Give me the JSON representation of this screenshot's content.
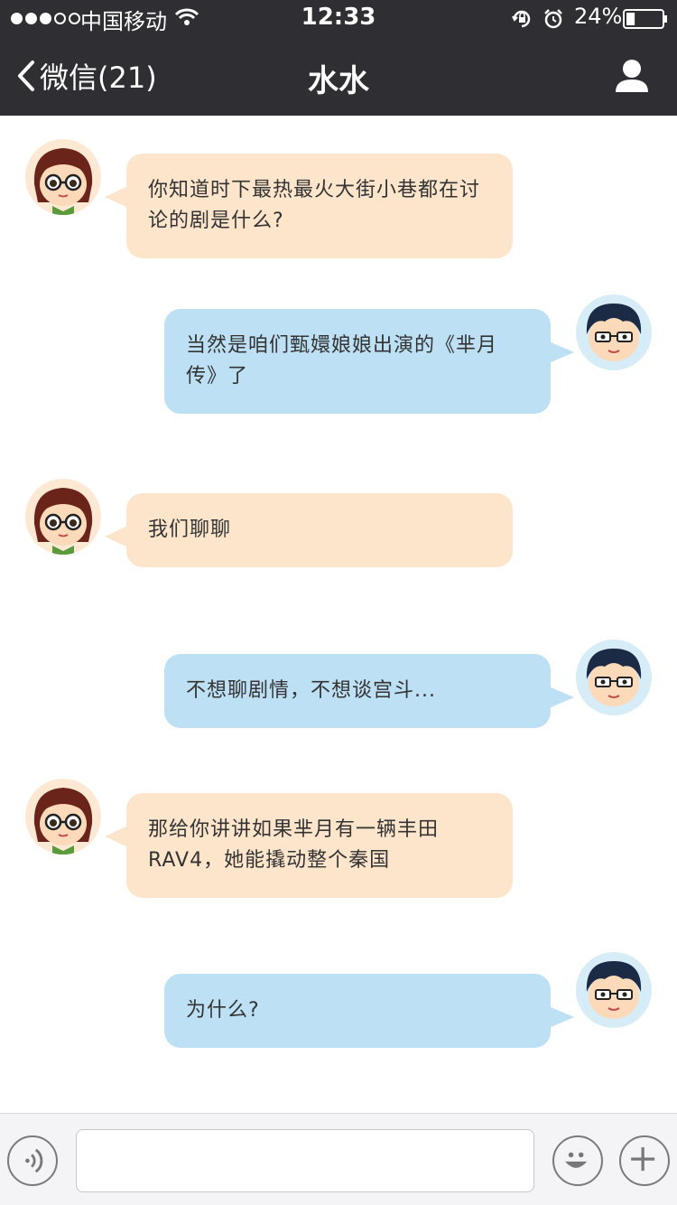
{
  "status_bar": {
    "signal_bars": [
      true,
      true,
      true,
      false,
      false
    ],
    "carrier": "中国移动",
    "time": "12:33",
    "battery_percent": "24%",
    "battery_level": 0.24
  },
  "nav": {
    "back_label": "微信(21)",
    "title": "水水"
  },
  "messages": [
    {
      "side": "left",
      "text": "你知道时下最热最火大街小巷都在讨论的剧是什么?"
    },
    {
      "side": "right",
      "text": "当然是咱们甄嬛娘娘出演的《芈月传》了"
    },
    {
      "side": "left",
      "text": "我们聊聊"
    },
    {
      "side": "right",
      "text": "不想聊剧情，不想谈宫斗..."
    },
    {
      "side": "left",
      "text": "那给你讲讲如果芈月有一辆丰田RAV4，她能撬动整个秦国"
    },
    {
      "side": "right",
      "text": "为什么?"
    }
  ],
  "input": {
    "value": "",
    "placeholder": ""
  },
  "icons": {
    "back": "chevron-left-icon",
    "profile": "person-icon",
    "voice": "voice-icon",
    "emoji": "smiley-icon",
    "plus": "plus-icon"
  },
  "colors": {
    "nav_bg": "#2f2f33",
    "left_bubble": "#fde5cc",
    "right_bubble": "#bde0f5"
  }
}
